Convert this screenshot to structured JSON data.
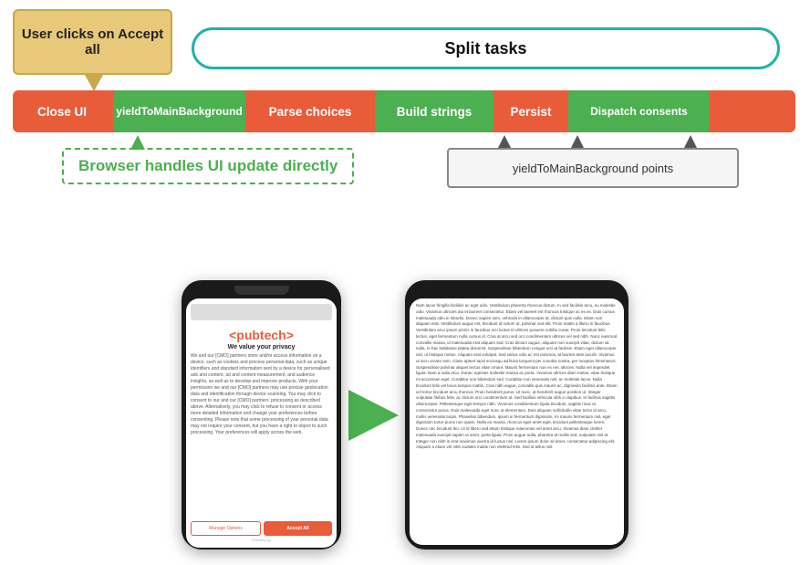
{
  "diagram": {
    "user_clicks_label": "User clicks on Accept all",
    "split_tasks_label": "Split tasks",
    "pipeline": {
      "close_ui": "Close UI",
      "yield_bg": "yieldToMainBackground",
      "parse_choices": "Parse choices",
      "build_strings": "Build strings",
      "persist": "Persist",
      "dispatch_consents": "Dispatch consents"
    },
    "browser_handles": "Browser handles UI update directly",
    "yield_points": "yieldToMainBackground  points"
  },
  "phone1": {
    "logo": "<pubtech>",
    "subtitle": "We value your privacy",
    "body_text": "We and our [CMO] partners store and/or access information on a device, such as cookies and process personal data, such as unique identifiers and standard information sent by a device for personalised ads and content, ad and content measurement, and audience insights, as well as to develop and improve products. With your permission we and our [CMO] partners may use precise geolocation data and identification through device scanning. You may click to consent to our and our [CMO] partners' processing as described above. Alternatively, you may click to refuse to consent or access more detailed information and change your preferences before consenting. Please note that some processing of your personal data may not require your consent, but you have a right to object to such processing. Your preferences will apply across the web.",
    "manage_options": "Manage Options",
    "accept_all": "Accept All",
    "powered_by": "Powered by"
  },
  "phone2": {
    "article_text": "Nam lacus fringilla facilisis ac eget odio. Vestibulum pharetra rhoncus dictum. In sed facilisis arcu, eu molestie odio. Vivamus ultricies dui et laoreet consectetur. Etiam vel laoreet est rhoncus tristique ac ex ex. Duis cursus malesuada odio in lobortis. Donec sapien sem, vehicula in ullamcorper at, dictum quis nulla. Etiam non aliquam erat. Vestibulum augue est, tincidunt id rutrum ut, pulvinar sed elit. Proin mattis a libero in faucibus. Vestibulum arcu ipsum primis in faucibus orci luctus et ultrices posuere cubilia curae; Proin tincidunt felis lectus, eget fermentum nulla cursus id. Cras at arcu sed orci condimentum ultrices vel sed nibh. Nunc euismod convallis massa, id malesuada erat aliquam sed. Cras dictum augue, aliquam non suscipit vitae, dictum sit. nulla. In hac habitasse platea dictumst. Suspendisse bibendum congue orci at facilisis. Etiam eget ullamcorper nisl, ut tristique metus. Aliquam erat volutpat. Sed varius odio ac est euismos, at laoreet ante iaculis. Vivamus ut arcu ornare sem. Class aptent taciti sociosqu ad litora torquent per conubia nostra, per inceptos himenaeos. Suspendisse pulvinar aliquet lectus vitae ornare. Mauris fermentum non ex nec ultrices. Nulla vel imperdiet ligula. Nam a nulla arcu. Donec egestas molestie massa ac porta. Vivamus ultrices diam metus, vitae tristique mi accumsan eget. Curabitur non bibendum sed. Curabitur non venenatis nisl, ac molestie lacus. Nulla tincidunt felis vel lacus tempus mattis. Cras nibh augue, convallis quis mauris ac, dignissim facilisis ante. Etiam vel tortor tincidunt arcu rhoncus. Proin hendrerit purus. Ut nunc, at hendrerit augue position ut. Integer vulputate finibus felis, ac dictum orci condimentum at. Sed facilisis vehicula nibh in dapibus. In facilisis sagittis ullamcorper. Pellentesque eget tempor nibh. Vivamus condimentum ligula tincidunt, sagittis risus ut, consectetur purus. Duis malesuada eget nunc ut elementum. Duis aliquam sollicitudin vitae tortor id arcu, mollis venenatis turpis. Phasellus bibendum, ipsum in fermentum dignissim, mi mauris fermentum nisl, eget dignissim tortor purus non quam. Nulla eu massa, rhoncus eget amet eget, tincidunt pellentesque lorem. Donec nec tincidunt leo. Ut id libero sed etiam tristique maecenas vel amet arcu. Vivamus diam clother malesuada suscipit sapien ut amet, porta ligula. Proin augue nulla, pharetra id mollis sed, vulputate nisl at. Integer non nibh in erat maximus viverra id luctus nisl. Lorem ipsum dolor sit amet, consectetur adipiscing elit. Aliquam a etiam vel nibh sodales mattis non eleifend felis. Sed id tellus nisl."
  },
  "colors": {
    "orange_box": "#e8c97a",
    "pipeline_red": "#e85c3a",
    "green": "#4caf50",
    "teal_border": "#20b2aa"
  }
}
